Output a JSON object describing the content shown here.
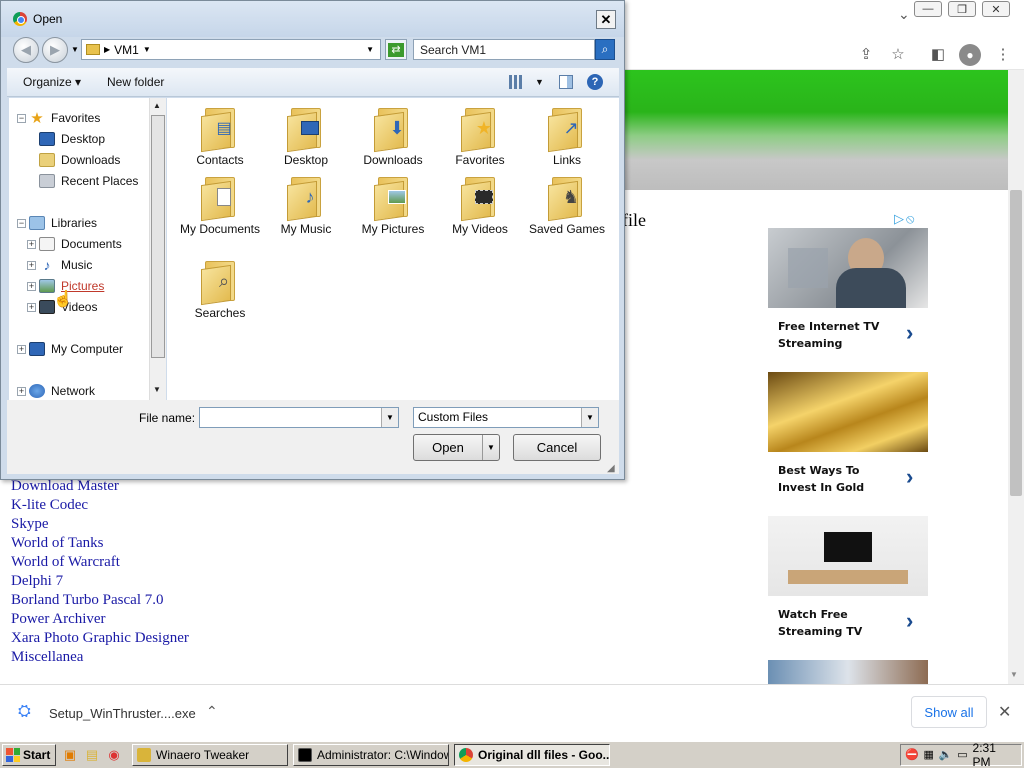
{
  "browser": {
    "page_text_file": "file",
    "adchoices": "▷⦸",
    "ads": [
      {
        "text": "Free Internet TV Streaming"
      },
      {
        "text": "Best Ways To Invest In Gold"
      },
      {
        "text": "Watch Free Streaming TV"
      }
    ],
    "links": [
      "Download Master",
      "K-lite Codec",
      "Skype",
      "World of Tanks",
      "World of Warcraft",
      "Delphi 7",
      "Borland Turbo Pascal 7.0",
      "Power Archiver",
      "Xara Photo Graphic Designer",
      "Miscellanea"
    ],
    "download": {
      "file": "Setup_WinThruster....exe",
      "show_all": "Show all"
    }
  },
  "dialog": {
    "title": "Open",
    "path": "VM1",
    "search_placeholder": "Search VM1",
    "toolbar": {
      "organize": "Organize",
      "new_folder": "New folder"
    },
    "tree": {
      "favorites": "Favorites",
      "desktop": "Desktop",
      "downloads": "Downloads",
      "recent": "Recent Places",
      "libraries": "Libraries",
      "documents": "Documents",
      "music": "Music",
      "pictures": "Pictures",
      "videos": "Videos",
      "computer": "My Computer",
      "network": "Network"
    },
    "items": [
      "Contacts",
      "Desktop",
      "Downloads",
      "Favorites",
      "Links",
      "My Documents",
      "My Music",
      "My Pictures",
      "My Videos",
      "Saved Games",
      "Searches"
    ],
    "file_name_label": "File name:",
    "file_name_value": "",
    "file_type": "Custom Files",
    "open": "Open",
    "cancel": "Cancel"
  },
  "taskbar": {
    "start": "Start",
    "tasks": [
      "Winaero Tweaker",
      "Administrator: C:\\Window...",
      "Original dll files - Goo..."
    ],
    "clock": "2:31 PM"
  }
}
